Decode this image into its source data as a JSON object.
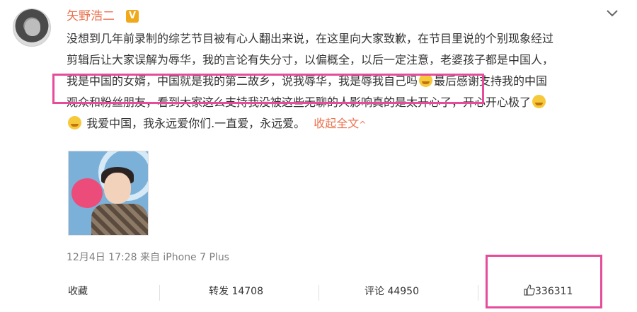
{
  "post": {
    "author": "矢野浩二",
    "verified_badge": "V",
    "lines": [
      "没想到几年前录制的综艺节目被有心人翻出来说，在这里向大家致歉，在节目里说的个别现象经过",
      "剪辑后让大家误解为辱华，我的言论有失分寸，以偏概全，以后一定注意，老婆孩子都是中国人，",
      "我是中国的女婿，中国就是我的第二故乡，说我辱华，我是辱我自己吗",
      "最后感谢支持我的中国",
      "观众和粉丝朋友，看到大家这么支持我没被这些无聊的人影响真的是太开心了，开心开心极了",
      "我爱中国，我永远爱你们.一直爱，永远爱。"
    ],
    "collapse_label": "收起全文",
    "collapse_arrow": "^",
    "meta": "12月4日 17:28 来自 iPhone 7 Plus"
  },
  "actions": {
    "favorite": "收藏",
    "repost": "转发 14708",
    "comment": "评论 44950",
    "like": "336311"
  },
  "colors": {
    "username": "#eb7350",
    "highlight": "#e64c9a",
    "link": "#eb7350"
  }
}
